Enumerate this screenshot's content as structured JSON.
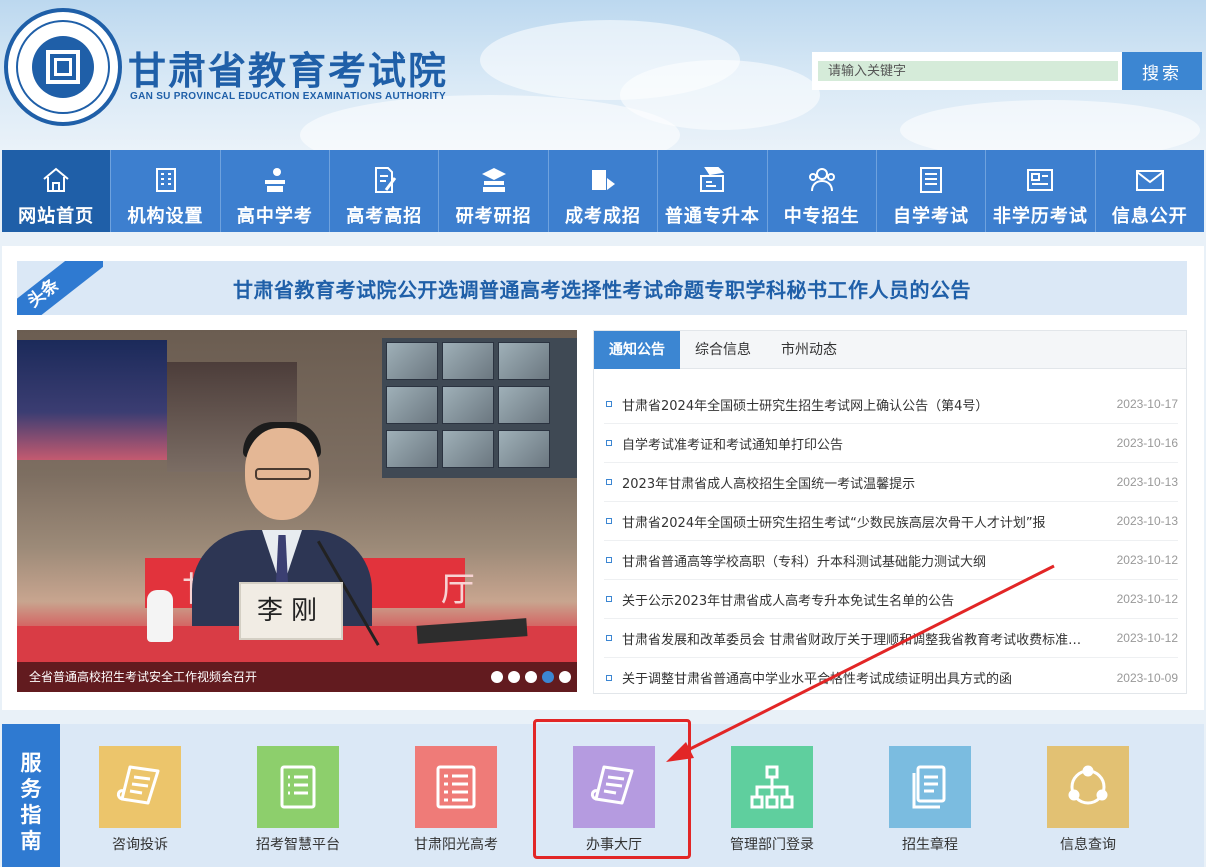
{
  "header": {
    "title": "甘肃省教育考试院",
    "subtitle": "GAN SU PROVINCAL EDUCATION EXAMINATIONS AUTHORITY",
    "search_placeholder": "请输入关键字",
    "search_button": "搜索",
    "brand_color": "#1f5fa8"
  },
  "nav": {
    "items": [
      {
        "label": "网站首页",
        "icon": "home-icon"
      },
      {
        "label": "机构设置",
        "icon": "building-icon"
      },
      {
        "label": "高中学考",
        "icon": "student-desk-icon"
      },
      {
        "label": "高考高招",
        "icon": "pencil-paper-icon"
      },
      {
        "label": "研考研招",
        "icon": "books-stack-icon"
      },
      {
        "label": "成考成招",
        "icon": "book-pen-icon"
      },
      {
        "label": "普通专升本",
        "icon": "graduation-cap-icon"
      },
      {
        "label": "中专招生",
        "icon": "group-icon"
      },
      {
        "label": "自学考试",
        "icon": "document-list-icon"
      },
      {
        "label": "非学历考试",
        "icon": "certificate-icon"
      },
      {
        "label": "信息公开",
        "icon": "mail-icon"
      }
    ]
  },
  "headline": {
    "tag": "头条",
    "text": "甘肃省教育考试院公开选调普通高考选择性考试命题专职学科秘书工作人员的公告"
  },
  "slider": {
    "caption": "全省普通高校招生考试安全工作视频会召开",
    "nameplate": "李刚",
    "wall_text": "甘肃  厅",
    "active_index": 3,
    "count": 5
  },
  "news": {
    "tabs": [
      "通知公告",
      "综合信息",
      "市州动态"
    ],
    "items": [
      {
        "title": "甘肃省2024年全国硕士研究生招生考试网上确认公告（第4号）",
        "date": "2023-10-17"
      },
      {
        "title": "自学考试准考证和考试通知单打印公告",
        "date": "2023-10-16"
      },
      {
        "title": "2023年甘肃省成人高校招生全国统一考试温馨提示",
        "date": "2023-10-13"
      },
      {
        "title": "甘肃省2024年全国硕士研究生招生考试“少数民族高层次骨干人才计划”报",
        "date": "2023-10-13"
      },
      {
        "title": "甘肃省普通高等学校高职（专科）升本科测试基础能力测试大纲",
        "date": "2023-10-12"
      },
      {
        "title": "关于公示2023年甘肃省成人高考专升本免试生名单的公告",
        "date": "2023-10-12"
      },
      {
        "title": "甘肃省发展和改革委员会 甘肃省财政厅关于理顺和调整我省教育考试收费标准的通知",
        "date": "2023-10-12"
      },
      {
        "title": "关于调整甘肃省普通高中学业水平合格性考试成绩证明出具方式的函",
        "date": "2023-10-09"
      }
    ]
  },
  "service": {
    "label": "服务指南",
    "items": [
      {
        "label": "咨询投诉",
        "color": "#ecc56b",
        "icon": "scroll-icon"
      },
      {
        "label": "招考智慧平台",
        "color": "#8dcf6c",
        "icon": "checklist-icon"
      },
      {
        "label": "甘肃阳光高考",
        "color": "#ef7b78",
        "icon": "list-icon"
      },
      {
        "label": "办事大厅",
        "color": "#b59be0",
        "icon": "scroll-icon"
      },
      {
        "label": "管理部门登录",
        "color": "#5fcf9e",
        "icon": "org-chart-icon"
      },
      {
        "label": "招生章程",
        "color": "#7bbce0",
        "icon": "document-icon"
      },
      {
        "label": "信息查询",
        "color": "#e2c173",
        "icon": "share-icon"
      }
    ]
  }
}
